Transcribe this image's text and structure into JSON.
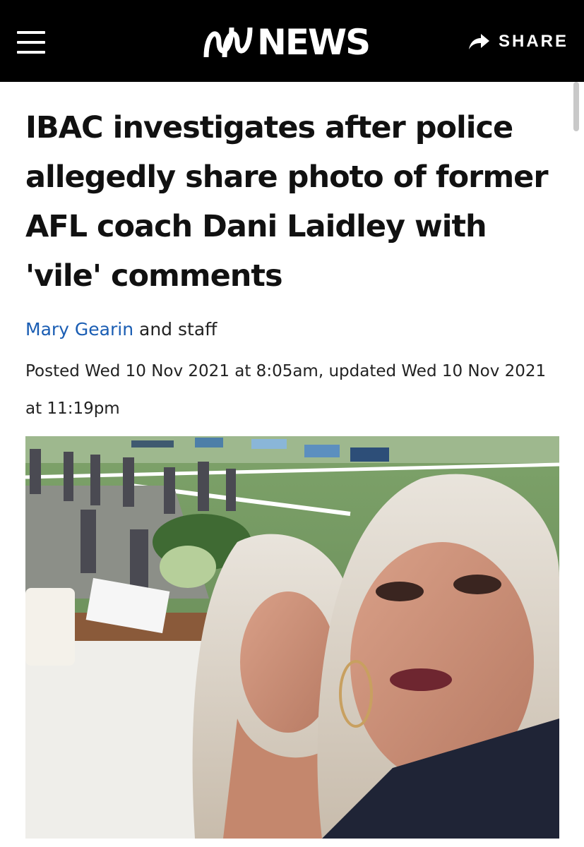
{
  "header": {
    "brand": "NEWS",
    "share_label": "SHARE",
    "colors": {
      "bar": "#000000",
      "text": "#ffffff"
    },
    "icons": {
      "menu": "hamburger-menu-icon",
      "logo": "abc-logo-icon",
      "share": "share-arrow-icon"
    }
  },
  "article": {
    "headline": "IBAC investigates after police allegedly share photo of former AFL coach Dani Laidley with 'vile' comments",
    "byline": {
      "author": "Mary Gearin",
      "suffix": " and staff",
      "author_color": "#1a5db3"
    },
    "timestamp": "Posted Wed 10 Nov 2021 at 8:05am, updated Wed 10 Nov 2021 at 11:19pm"
  }
}
